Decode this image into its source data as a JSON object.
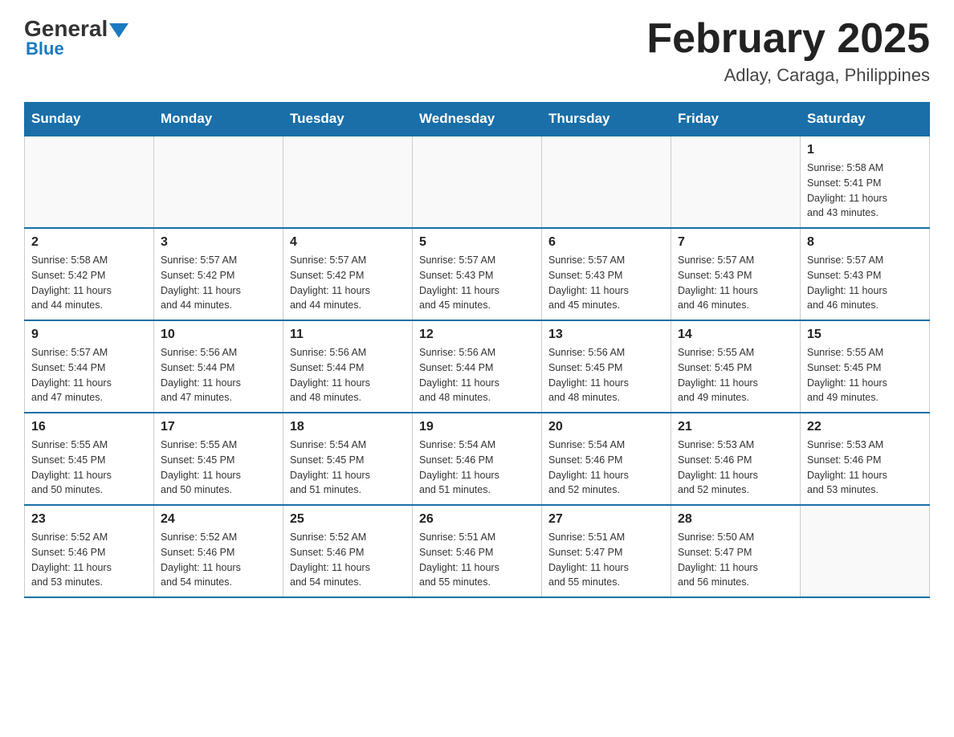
{
  "header": {
    "logo_general": "General",
    "logo_blue": "Blue",
    "month_year": "February 2025",
    "location": "Adlay, Caraga, Philippines"
  },
  "days_of_week": [
    "Sunday",
    "Monday",
    "Tuesday",
    "Wednesday",
    "Thursday",
    "Friday",
    "Saturday"
  ],
  "weeks": [
    [
      {
        "day": "",
        "info": ""
      },
      {
        "day": "",
        "info": ""
      },
      {
        "day": "",
        "info": ""
      },
      {
        "day": "",
        "info": ""
      },
      {
        "day": "",
        "info": ""
      },
      {
        "day": "",
        "info": ""
      },
      {
        "day": "1",
        "info": "Sunrise: 5:58 AM\nSunset: 5:41 PM\nDaylight: 11 hours\nand 43 minutes."
      }
    ],
    [
      {
        "day": "2",
        "info": "Sunrise: 5:58 AM\nSunset: 5:42 PM\nDaylight: 11 hours\nand 44 minutes."
      },
      {
        "day": "3",
        "info": "Sunrise: 5:57 AM\nSunset: 5:42 PM\nDaylight: 11 hours\nand 44 minutes."
      },
      {
        "day": "4",
        "info": "Sunrise: 5:57 AM\nSunset: 5:42 PM\nDaylight: 11 hours\nand 44 minutes."
      },
      {
        "day": "5",
        "info": "Sunrise: 5:57 AM\nSunset: 5:43 PM\nDaylight: 11 hours\nand 45 minutes."
      },
      {
        "day": "6",
        "info": "Sunrise: 5:57 AM\nSunset: 5:43 PM\nDaylight: 11 hours\nand 45 minutes."
      },
      {
        "day": "7",
        "info": "Sunrise: 5:57 AM\nSunset: 5:43 PM\nDaylight: 11 hours\nand 46 minutes."
      },
      {
        "day": "8",
        "info": "Sunrise: 5:57 AM\nSunset: 5:43 PM\nDaylight: 11 hours\nand 46 minutes."
      }
    ],
    [
      {
        "day": "9",
        "info": "Sunrise: 5:57 AM\nSunset: 5:44 PM\nDaylight: 11 hours\nand 47 minutes."
      },
      {
        "day": "10",
        "info": "Sunrise: 5:56 AM\nSunset: 5:44 PM\nDaylight: 11 hours\nand 47 minutes."
      },
      {
        "day": "11",
        "info": "Sunrise: 5:56 AM\nSunset: 5:44 PM\nDaylight: 11 hours\nand 48 minutes."
      },
      {
        "day": "12",
        "info": "Sunrise: 5:56 AM\nSunset: 5:44 PM\nDaylight: 11 hours\nand 48 minutes."
      },
      {
        "day": "13",
        "info": "Sunrise: 5:56 AM\nSunset: 5:45 PM\nDaylight: 11 hours\nand 48 minutes."
      },
      {
        "day": "14",
        "info": "Sunrise: 5:55 AM\nSunset: 5:45 PM\nDaylight: 11 hours\nand 49 minutes."
      },
      {
        "day": "15",
        "info": "Sunrise: 5:55 AM\nSunset: 5:45 PM\nDaylight: 11 hours\nand 49 minutes."
      }
    ],
    [
      {
        "day": "16",
        "info": "Sunrise: 5:55 AM\nSunset: 5:45 PM\nDaylight: 11 hours\nand 50 minutes."
      },
      {
        "day": "17",
        "info": "Sunrise: 5:55 AM\nSunset: 5:45 PM\nDaylight: 11 hours\nand 50 minutes."
      },
      {
        "day": "18",
        "info": "Sunrise: 5:54 AM\nSunset: 5:45 PM\nDaylight: 11 hours\nand 51 minutes."
      },
      {
        "day": "19",
        "info": "Sunrise: 5:54 AM\nSunset: 5:46 PM\nDaylight: 11 hours\nand 51 minutes."
      },
      {
        "day": "20",
        "info": "Sunrise: 5:54 AM\nSunset: 5:46 PM\nDaylight: 11 hours\nand 52 minutes."
      },
      {
        "day": "21",
        "info": "Sunrise: 5:53 AM\nSunset: 5:46 PM\nDaylight: 11 hours\nand 52 minutes."
      },
      {
        "day": "22",
        "info": "Sunrise: 5:53 AM\nSunset: 5:46 PM\nDaylight: 11 hours\nand 53 minutes."
      }
    ],
    [
      {
        "day": "23",
        "info": "Sunrise: 5:52 AM\nSunset: 5:46 PM\nDaylight: 11 hours\nand 53 minutes."
      },
      {
        "day": "24",
        "info": "Sunrise: 5:52 AM\nSunset: 5:46 PM\nDaylight: 11 hours\nand 54 minutes."
      },
      {
        "day": "25",
        "info": "Sunrise: 5:52 AM\nSunset: 5:46 PM\nDaylight: 11 hours\nand 54 minutes."
      },
      {
        "day": "26",
        "info": "Sunrise: 5:51 AM\nSunset: 5:46 PM\nDaylight: 11 hours\nand 55 minutes."
      },
      {
        "day": "27",
        "info": "Sunrise: 5:51 AM\nSunset: 5:47 PM\nDaylight: 11 hours\nand 55 minutes."
      },
      {
        "day": "28",
        "info": "Sunrise: 5:50 AM\nSunset: 5:47 PM\nDaylight: 11 hours\nand 56 minutes."
      },
      {
        "day": "",
        "info": ""
      }
    ]
  ]
}
